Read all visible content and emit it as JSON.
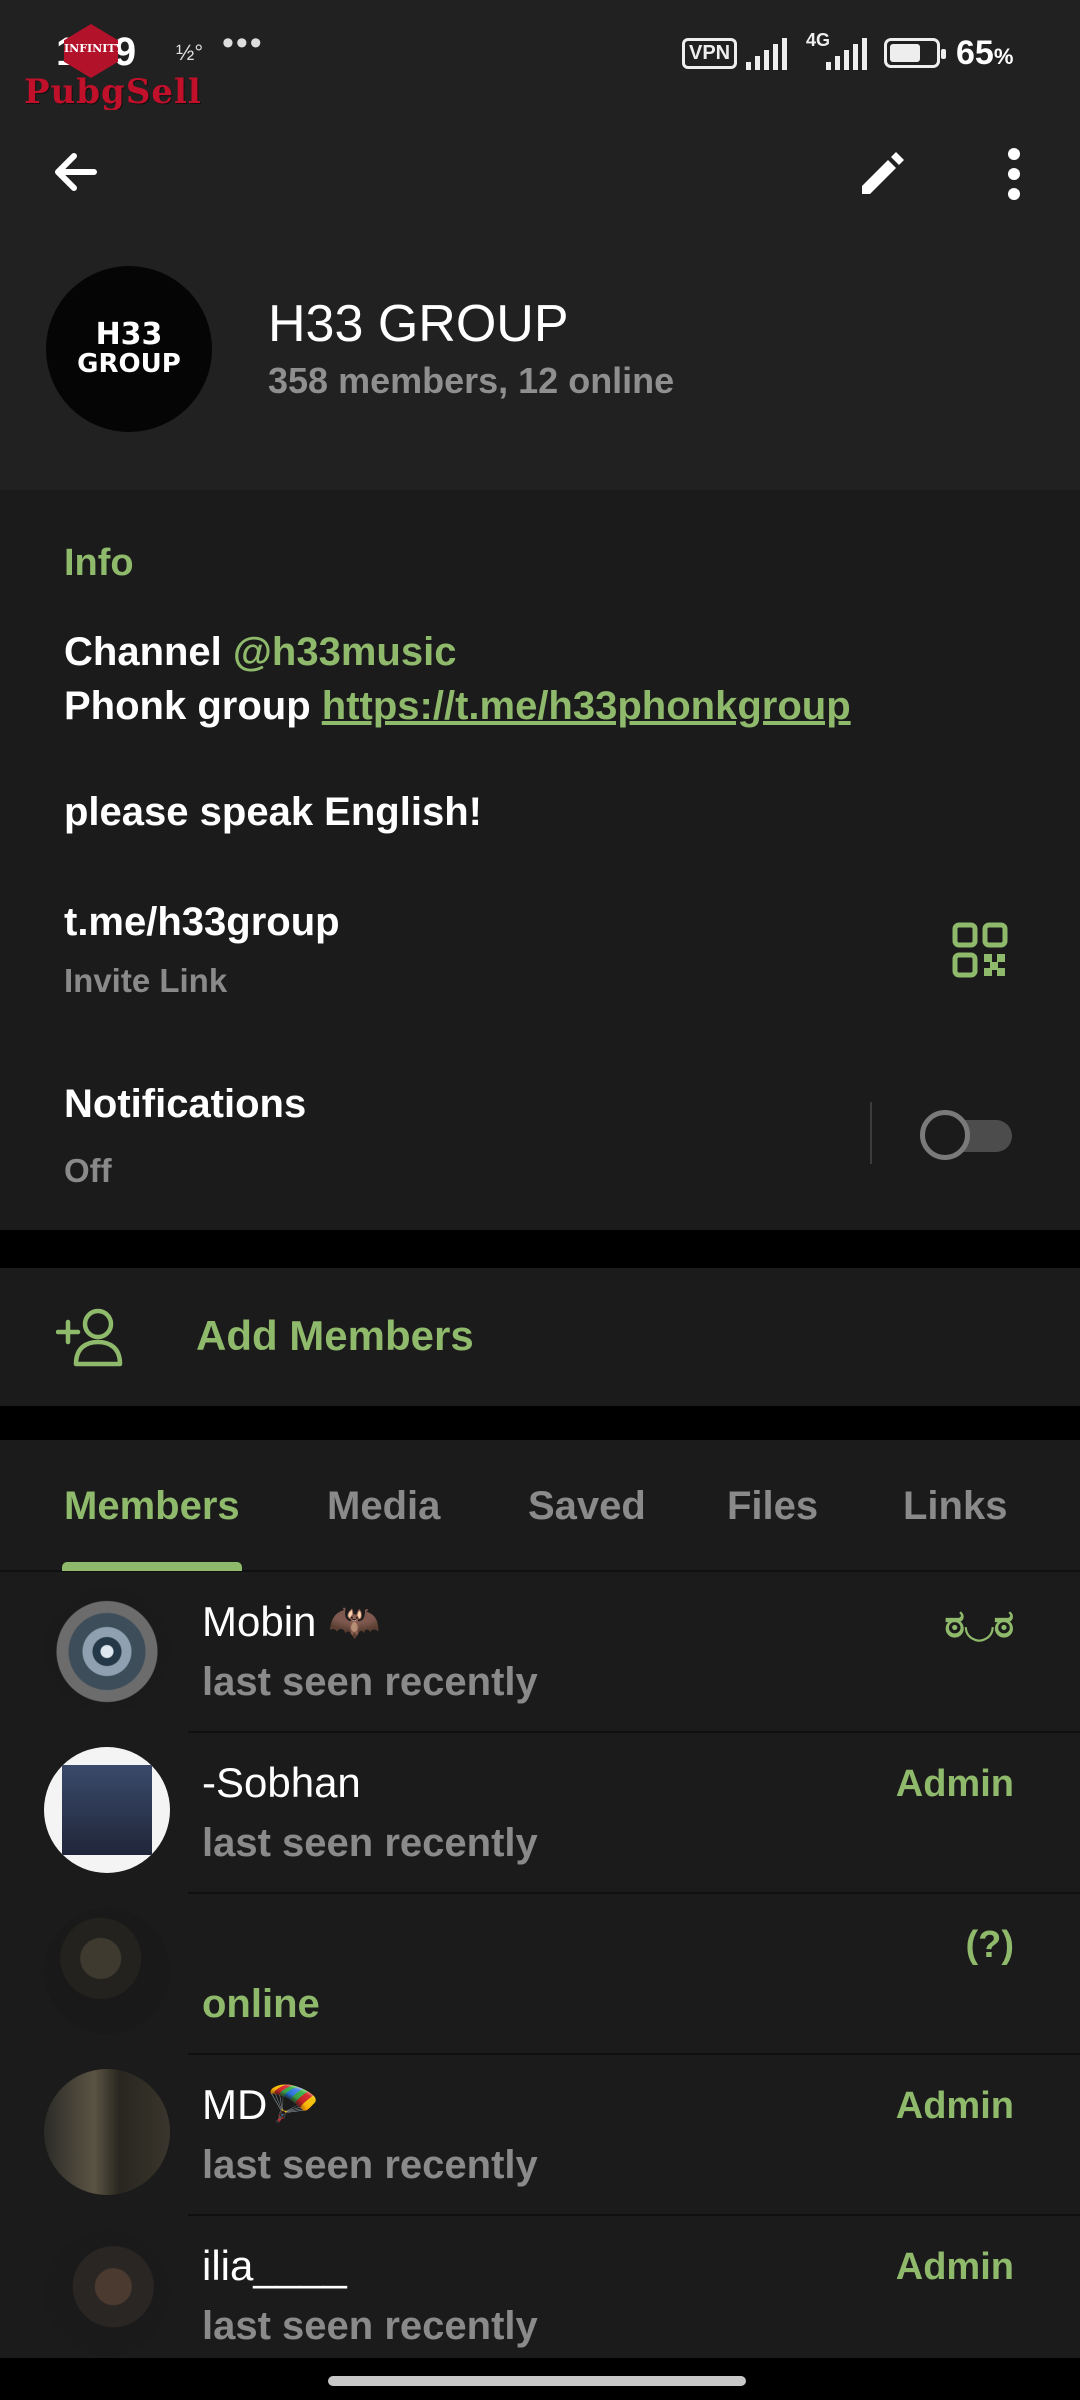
{
  "status_bar": {
    "time": "1:19",
    "speed": "½°",
    "dots": "•••",
    "vpn": "VPN",
    "network": "4G",
    "battery_pct": "65",
    "battery_unit": "%"
  },
  "watermark": {
    "text": "PubgSell",
    "badge": "INFINITY"
  },
  "header": {
    "title": "H33 GROUP",
    "subtitle": "358 members, 12 online",
    "avatar_top": "H33",
    "avatar_bottom": "GROUP",
    "icons": [
      "arrow-left-icon",
      "pencil-icon",
      "more-vertical-icon"
    ]
  },
  "info": {
    "heading": "Info",
    "line1_prefix": "Channel ",
    "line1_handle": "@h33music",
    "line2_prefix": "Phonk group ",
    "line2_link": "https://t.me/h33phonkgroup",
    "line3": "please speak English!",
    "invite_link": "t.me/h33group",
    "invite_label": "Invite Link",
    "notifications_title": "Notifications",
    "notifications_state": "Off"
  },
  "add_members": {
    "label": "Add Members"
  },
  "tabs": [
    {
      "label": "Members",
      "active": true
    },
    {
      "label": "Media",
      "active": false
    },
    {
      "label": "Saved",
      "active": false
    },
    {
      "label": "Files",
      "active": false
    },
    {
      "label": "Links",
      "active": false
    }
  ],
  "members": [
    {
      "name": "Mobin 🦇",
      "status": "last seen recently",
      "role": "ಠ◡ಠ"
    },
    {
      "name": "-Sobhan",
      "status": "last seen recently",
      "role": "Admin"
    },
    {
      "name": "",
      "status": "online",
      "role": "(?)"
    },
    {
      "name": "MD🪂",
      "status": "last seen recently",
      "role": "Admin"
    },
    {
      "name": "ilia____",
      "status": "last seen recently",
      "role": "Admin"
    }
  ],
  "colors": {
    "accent": "#8fb96b",
    "background": "#1b1b1b",
    "header": "#212121"
  }
}
